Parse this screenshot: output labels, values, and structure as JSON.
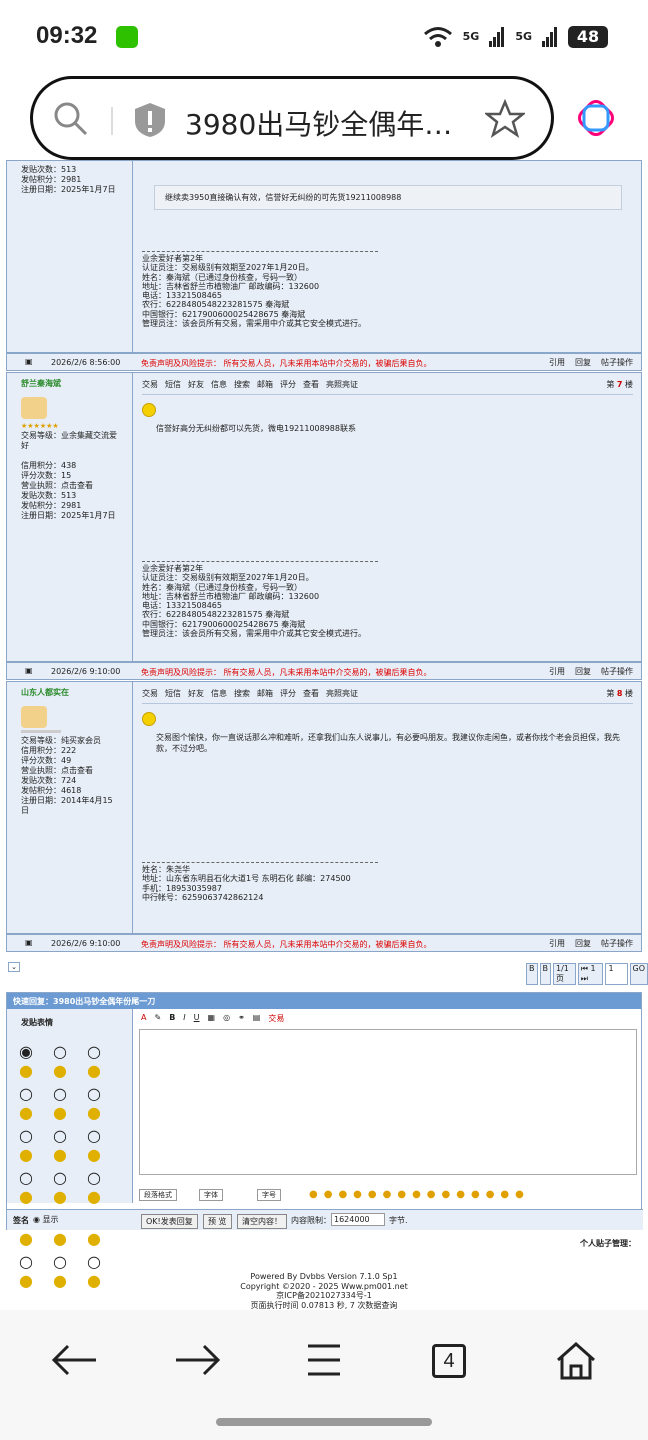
{
  "status": {
    "time": "09:32",
    "battery": "48",
    "signal1": "5G",
    "signal2": "5G"
  },
  "browser": {
    "url_title": "3980出马钞全偶年…",
    "tab_count": "4"
  },
  "top_fragment": {
    "stats": [
      "发贴次数：513",
      "发帖积分：2981",
      "注册日期：2025年1月7日"
    ],
    "quote": "继续卖3950直接确认有效，信誉好无纠纷的可先货19211008988",
    "sig": [
      "业余爱好者第2年",
      "认证员注：交易级别有效期至2027年1月20日。",
      "姓名：秦海斌（已通过身份核查，号码一致）",
      "地址：吉林省舒兰市植物油厂 邮政编码：132600",
      "电话：13321508465",
      "农行：6228480548223281575 秦海斌",
      "中国银行：6217900600025428675 秦海斌",
      "管理员注：该会员所有交易，需采用中介或其它安全模式进行。"
    ]
  },
  "footer_common": {
    "warn": "免责声明及风险提示： 所有交易人员，凡未采用本站中介交易的，被骗后果自负。",
    "reply": "引用",
    "reply2": "回复",
    "ops": "帖子操作"
  },
  "posts": [
    {
      "footer_date": "2026/2/6 8:56:00",
      "name": "舒兰秦海斌",
      "info": [
        "交易等级：业余集藏交流爱好",
        "",
        "信用积分：438",
        "评分次数：15",
        "营业执照：点击查看",
        "发贴次数：513",
        "发帖积分：2981",
        "注册日期：2025年1月7日"
      ],
      "floor": "7",
      "content": "信誉好高分无纠纷都可以先货，微电19211008988联系",
      "sig": [
        "业余爱好者第2年",
        "认证员注：交易级别有效期至2027年1月20日。",
        "姓名：秦海斌（已通过身份核查，号码一致）",
        "地址：吉林省舒兰市植物油厂 邮政编码：132600",
        "电话：13321508465",
        "农行：6228480548223281575 秦海斌",
        "中国银行：6217900600025428675 秦海斌",
        "管理员注：该会员所有交易，需采用中介或其它安全模式进行。"
      ],
      "footer_date2": "2026/2/6 9:10:00"
    },
    {
      "name": "山东人都实在",
      "info": [
        "交易等级：纯买家会员",
        "信用积分：222",
        "评分次数：49",
        "营业执照：点击查看",
        "发贴次数：724",
        "发帖积分：4618",
        "注册日期：2014年4月15日"
      ],
      "floor": "8",
      "content": "交易图个愉快，你一直说话那么冲和难听，还拿我们山东人说事儿，有必要吗朋友。我建议你走闲鱼，或者你找个老会员担保，我先款，不过分吧。",
      "sig": [
        "姓名：朱尧华",
        "地址：山东省东明县石化大道1号 东明石化 邮编：274500",
        "手机：18953035987",
        "中行帐号：6259063742862124"
      ],
      "footer_date": "2026/2/6 9:10:00"
    }
  ],
  "toolbar": [
    "交易",
    "短信",
    "好友",
    "信息",
    "搜索",
    "邮箱",
    "评分",
    "查看",
    "亮照亮证"
  ],
  "floor_prefix": "第",
  "floor_suffix": "楼",
  "pager": [
    "B",
    "B",
    "1/1页",
    "⏮ 1 ⏭",
    "1",
    "GO"
  ],
  "quick": {
    "title": "快速回复：3980出马钞全偶年份尾一刀",
    "face_label": "发贴表情",
    "sign_label": "签名",
    "show_label": "显示",
    "trade": "交易",
    "sel1": "段落格式",
    "sel2": "字体",
    "sel3": "字号",
    "btn_submit": "OK!发表回复",
    "btn_preview": "预 览",
    "btn_clear": "清空内容！",
    "limit_label": "内容限制：",
    "limit_value": "1624000",
    "limit_unit": "字节."
  },
  "manage": "个人贴子管理：",
  "powered": [
    "Powered By Dvbbs Version 7.1.0 Sp1",
    "Copyright ©2020 - 2025 Www.pm001.net",
    "京ICP备2021027334号-1",
    "页面执行时间 0.07813 秒, 7 次数据查询"
  ]
}
